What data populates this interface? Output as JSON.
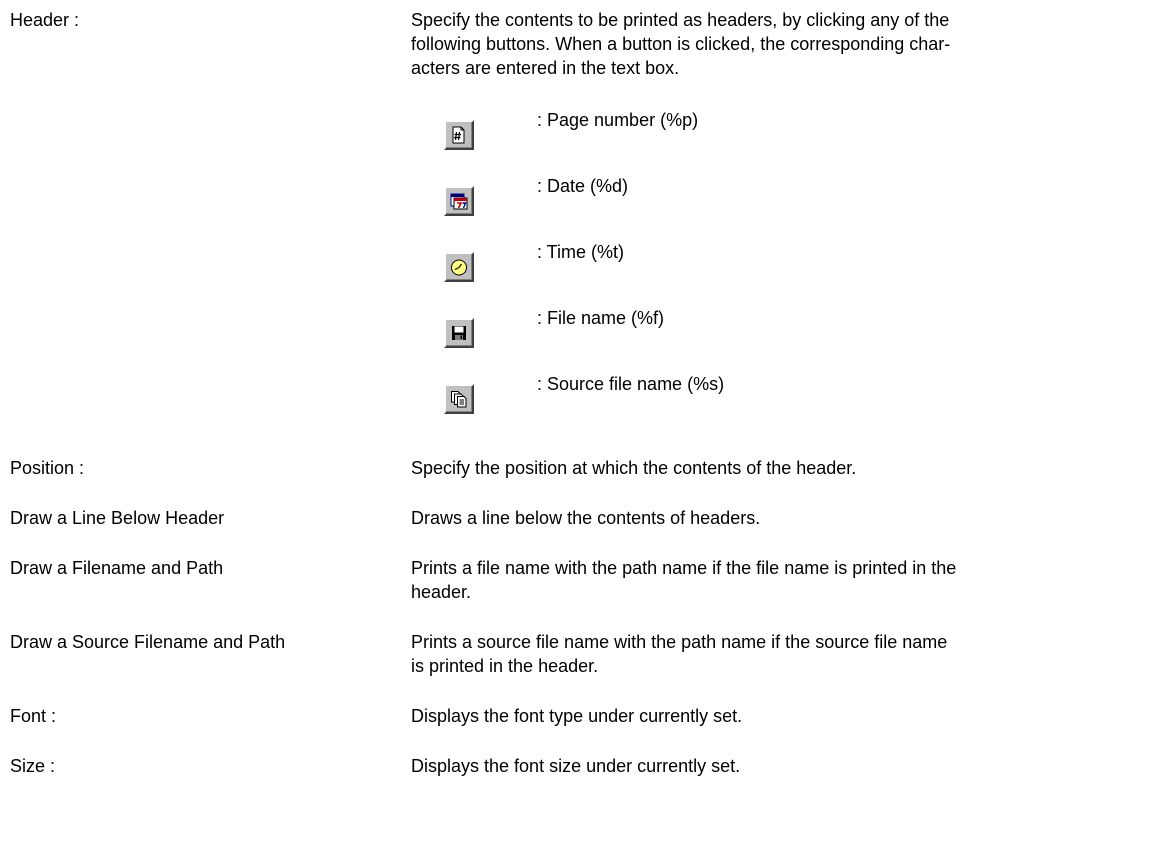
{
  "header": {
    "term": "Header :",
    "description": "Specify the contents to be printed as headers, by clicking any of the following buttons.  When a button is clicked, the corresponding char-acters are entered in the text box.",
    "description_lines": [
      "Specify the contents to be printed as headers, by clicking any of the",
      "following buttons.  When a button is clicked, the corresponding char-",
      "acters are entered in the text box."
    ],
    "buttons": [
      {
        "icon": "page-number-icon",
        "label": ": Page number (%p)"
      },
      {
        "icon": "date-icon",
        "label": ": Date (%d)"
      },
      {
        "icon": "time-icon",
        "label": ": Time (%t)"
      },
      {
        "icon": "file-name-icon",
        "label": ": File name (%f)"
      },
      {
        "icon": "source-file-name-icon",
        "label": ": Source file name (%s)"
      }
    ]
  },
  "entries": [
    {
      "term": "Position :",
      "lines": [
        "Specify the position at which the contents of the header."
      ]
    },
    {
      "term": "Draw a Line Below Header",
      "lines": [
        "Draws a line below the contents of headers."
      ]
    },
    {
      "term": "Draw a Filename and Path",
      "lines": [
        "Prints a file name with the path name if the file name is printed in the",
        "header."
      ]
    },
    {
      "term": "Draw a Source Filename and Path",
      "lines": [
        "Prints a source file name with the path name if the source file name",
        "is printed in the header."
      ]
    },
    {
      "term": "Font :",
      "lines": [
        "Displays the font type under currently set."
      ]
    },
    {
      "term": "Size :",
      "lines": [
        "Displays the font size under currently set."
      ]
    }
  ],
  "colors": {
    "text": "#000000",
    "button_face": "#c0c0c0",
    "button_highlight": "#ffffff",
    "button_shadow": "#404040",
    "clock_face": "#ffff80",
    "calendar_red": "#c00000",
    "calendar_blue": "#000080"
  }
}
